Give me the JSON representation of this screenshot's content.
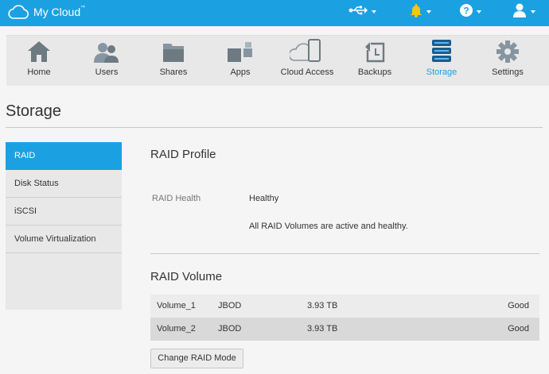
{
  "app": {
    "name": "My Cloud",
    "trademark": "™"
  },
  "topbar": {
    "icons": [
      "usb-icon",
      "bell-icon",
      "help-icon",
      "user-icon"
    ]
  },
  "nav": {
    "items": [
      {
        "label": "Home",
        "icon": "home-icon"
      },
      {
        "label": "Users",
        "icon": "users-icon"
      },
      {
        "label": "Shares",
        "icon": "shares-icon"
      },
      {
        "label": "Apps",
        "icon": "apps-icon"
      },
      {
        "label": "Cloud Access",
        "icon": "cloud-access-icon"
      },
      {
        "label": "Backups",
        "icon": "backups-icon"
      },
      {
        "label": "Storage",
        "icon": "storage-icon",
        "active": true
      },
      {
        "label": "Settings",
        "icon": "settings-icon"
      }
    ]
  },
  "page": {
    "title": "Storage"
  },
  "sidemenu": {
    "items": [
      {
        "label": "RAID",
        "active": true
      },
      {
        "label": "Disk Status"
      },
      {
        "label": "iSCSI"
      },
      {
        "label": "Volume Virtualization"
      }
    ]
  },
  "raid_profile": {
    "title": "RAID Profile",
    "health_label": "RAID Health",
    "health_value": "Healthy",
    "health_desc": "All RAID Volumes are active and healthy."
  },
  "raid_volume": {
    "title": "RAID Volume",
    "rows": [
      {
        "name": "Volume_1",
        "type": "JBOD",
        "size": "3.93 TB",
        "status": "Good"
      },
      {
        "name": "Volume_2",
        "type": "JBOD",
        "size": "3.93 TB",
        "status": "Good"
      }
    ],
    "button_label": "Change RAID Mode"
  },
  "colors": {
    "accent": "#1ba1e2",
    "nav_bg": "#e8e8e8",
    "page_bg": "#f5f5f5"
  }
}
